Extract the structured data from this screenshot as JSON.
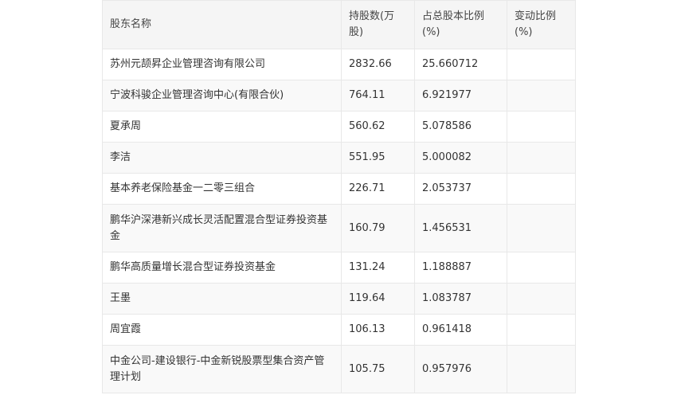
{
  "table": {
    "headers": [
      "股东名称",
      "持股数(万股)",
      "占总股本比例(%)",
      "变动比例(%)"
    ],
    "rows": [
      {
        "name": "苏州元颉昇企业管理咨询有限公司",
        "shares": "2832.66",
        "ratio": "25.660712",
        "change": ""
      },
      {
        "name": "宁波科骏企业管理咨询中心(有限合伙)",
        "shares": "764.11",
        "ratio": "6.921977",
        "change": ""
      },
      {
        "name": "夏承周",
        "shares": "560.62",
        "ratio": "5.078586",
        "change": ""
      },
      {
        "name": "李洁",
        "shares": "551.95",
        "ratio": "5.000082",
        "change": ""
      },
      {
        "name": "基本养老保险基金一二零三组合",
        "shares": "226.71",
        "ratio": "2.053737",
        "change": ""
      },
      {
        "name": "鹏华沪深港新兴成长灵活配置混合型证券投资基金",
        "shares": "160.79",
        "ratio": "1.456531",
        "change": ""
      },
      {
        "name": "鹏华高质量增长混合型证券投资基金",
        "shares": "131.24",
        "ratio": "1.188887",
        "change": ""
      },
      {
        "name": "王墨",
        "shares": "119.64",
        "ratio": "1.083787",
        "change": ""
      },
      {
        "name": "周宜霞",
        "shares": "106.13",
        "ratio": "0.961418",
        "change": ""
      },
      {
        "name": "中金公司-建设银行-中金新锐股票型集合资产管理计划",
        "shares": "105.75",
        "ratio": "0.957976",
        "change": ""
      }
    ]
  }
}
